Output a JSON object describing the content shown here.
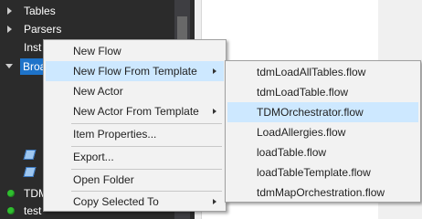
{
  "tree": {
    "items": [
      {
        "label": "Tables"
      },
      {
        "label": "Parsers"
      },
      {
        "label": "Inst"
      },
      {
        "label": "Broa"
      },
      {
        "label": "TDM"
      },
      {
        "label": "test"
      }
    ]
  },
  "context_menu": {
    "items": [
      {
        "label": "New Flow"
      },
      {
        "label": "New Flow From Template"
      },
      {
        "label": "New Actor"
      },
      {
        "label": "New Actor From Template"
      },
      {
        "label": "Item Properties..."
      },
      {
        "label": "Export..."
      },
      {
        "label": "Open Folder"
      },
      {
        "label": "Copy Selected To"
      }
    ]
  },
  "submenu": {
    "items": [
      {
        "label": "tdmLoadAllTables.flow"
      },
      {
        "label": "tdmLoadTable.flow"
      },
      {
        "label": "TDMOrchestrator.flow"
      },
      {
        "label": "LoadAllergies.flow"
      },
      {
        "label": "loadTable.flow"
      },
      {
        "label": "loadTableTemplate.flow"
      },
      {
        "label": "tdmMapOrchestration.flow"
      }
    ]
  },
  "colors": {
    "tree_bg": "#2b2b2b",
    "selection": "#1e73c9",
    "menu_bg": "#f2f2f2",
    "menu_highlight": "#cde8ff",
    "status_green": "#2fbf2f"
  }
}
